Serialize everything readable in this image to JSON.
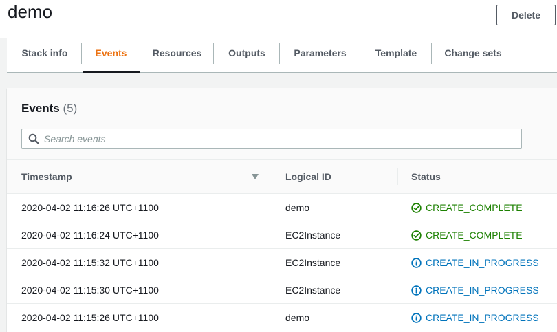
{
  "header": {
    "title": "demo",
    "delete_label": "Delete"
  },
  "tabs": [
    {
      "label": "Stack info",
      "active": false
    },
    {
      "label": "Events",
      "active": true
    },
    {
      "label": "Resources",
      "active": false
    },
    {
      "label": "Outputs",
      "active": false
    },
    {
      "label": "Parameters",
      "active": false
    },
    {
      "label": "Template",
      "active": false
    },
    {
      "label": "Change sets",
      "active": false
    }
  ],
  "events": {
    "title": "Events",
    "count": "(5)",
    "search_placeholder": "Search events",
    "columns": {
      "timestamp": "Timestamp",
      "logical_id": "Logical ID",
      "status": "Status"
    },
    "rows": [
      {
        "timestamp": "2020-04-02 11:16:26 UTC+1100",
        "logical_id": "demo",
        "status": "CREATE_COMPLETE",
        "status_type": "complete"
      },
      {
        "timestamp": "2020-04-02 11:16:24 UTC+1100",
        "logical_id": "EC2Instance",
        "status": "CREATE_COMPLETE",
        "status_type": "complete"
      },
      {
        "timestamp": "2020-04-02 11:15:32 UTC+1100",
        "logical_id": "EC2Instance",
        "status": "CREATE_IN_PROGRESS",
        "status_type": "in-progress"
      },
      {
        "timestamp": "2020-04-02 11:15:30 UTC+1100",
        "logical_id": "EC2Instance",
        "status": "CREATE_IN_PROGRESS",
        "status_type": "in-progress"
      },
      {
        "timestamp": "2020-04-02 11:15:26 UTC+1100",
        "logical_id": "demo",
        "status": "CREATE_IN_PROGRESS",
        "status_type": "in-progress"
      }
    ]
  },
  "colors": {
    "accent": "#ec7211",
    "success": "#1d8102",
    "info": "#0073bb"
  },
  "icons": {
    "search": "search-icon",
    "sort": "sort-descending-icon",
    "complete": "check-circle-icon",
    "in_progress": "info-circle-icon"
  }
}
